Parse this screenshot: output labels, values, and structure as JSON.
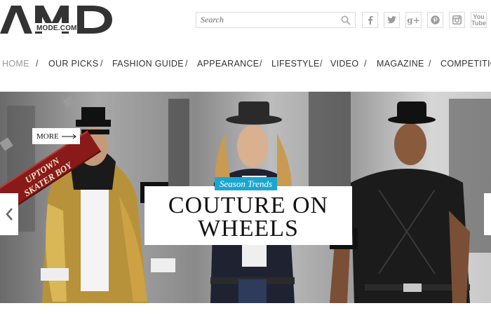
{
  "logo": {
    "text": "AMD",
    "subtext": "MODE.COM"
  },
  "search": {
    "placeholder": "Search"
  },
  "social": [
    {
      "icon": "facebook-icon",
      "glyph": "f"
    },
    {
      "icon": "twitter-icon",
      "glyph": "t"
    },
    {
      "icon": "google-plus-icon",
      "glyph": "g+"
    },
    {
      "icon": "pinterest-icon",
      "glyph": "p"
    },
    {
      "icon": "instagram-icon",
      "glyph": "◙"
    },
    {
      "icon": "youtube-icon",
      "glyph": "You"
    }
  ],
  "nav": {
    "items": [
      "HOME",
      "OUR PICKS",
      "FASHION GUIDE",
      "APPEARANCE",
      "LIFESTYLE",
      "VIDEO",
      "MAGAZINE",
      "COMPETITION"
    ],
    "active": "HOME",
    "separator": "/"
  },
  "hero": {
    "banner_line1": "UPTOWN",
    "banner_line2": "SKATER BOY",
    "more_label": "MORE",
    "tag": "Season Trends",
    "headline_line1": "COUTURE ON",
    "headline_line2": "WHEELS"
  },
  "colors": {
    "accent": "#1ba6d0",
    "banner": "#8a1a1a",
    "text": "#333333",
    "nav_active": "#9a9a9a"
  }
}
